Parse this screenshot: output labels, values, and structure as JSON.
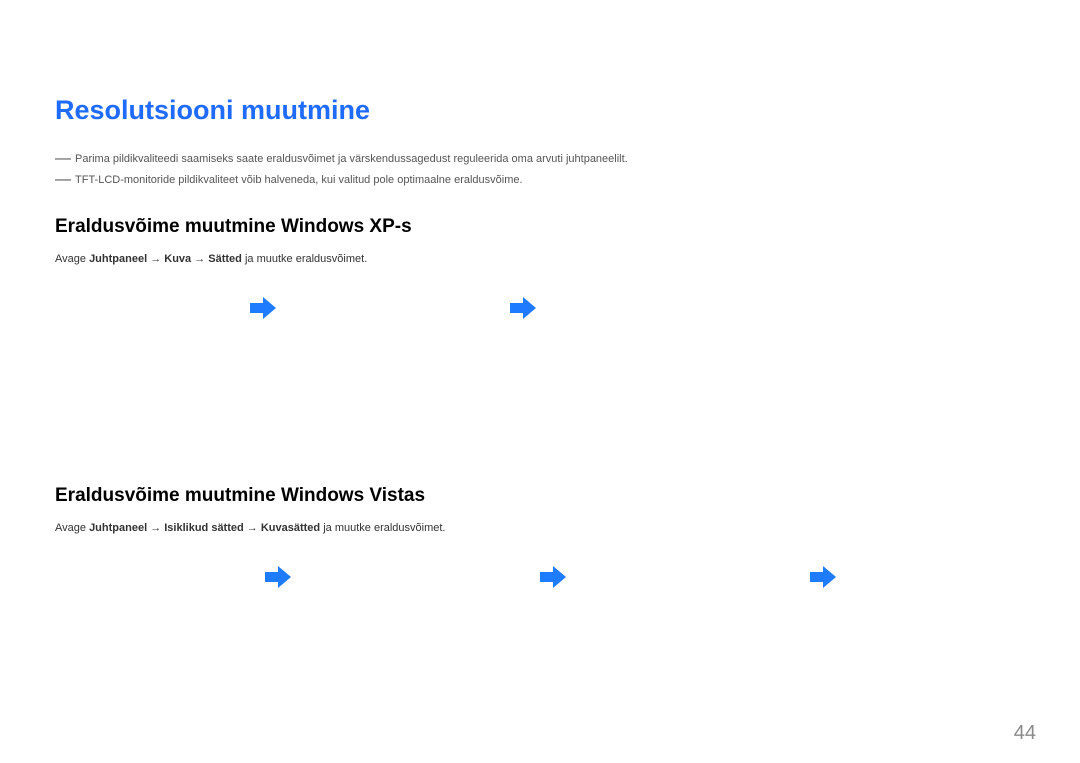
{
  "title": "Resolutsiooni muutmine",
  "notes": {
    "n1": "Parima pildikvaliteedi saamiseks saate eraldusvõimet ja värskendussagedust reguleerida oma arvuti juhtpaneelilt.",
    "n2": "TFT-LCD-monitoride pildikvaliteet võib halveneda, kui valitud pole optimaalne eraldusvõime."
  },
  "sectionXP": {
    "heading": "Eraldusvõime muutmine Windows XP-s",
    "prefix": "Avage ",
    "b1": "Juhtpaneel ",
    "arr1": "→ ",
    "b2": "Kuva ",
    "arr2": "→ ",
    "b3": "Sätted ",
    "suffix": "ja muutke eraldusvõimet."
  },
  "sectionVista": {
    "heading": "Eraldusvõime muutmine Windows Vistas",
    "prefix": "Avage ",
    "b1": "Juhtpaneel ",
    "arr1": "→ ",
    "b2": "Isiklikud sätted ",
    "arr2": "→ ",
    "b3": "Kuvasätted ",
    "suffix": "ja muutke eraldusvõimet."
  },
  "pageNumber": "44",
  "arrowPositionsXP": [
    "195",
    "455"
  ],
  "arrowPositionsVista": [
    "210",
    "485",
    "755"
  ]
}
